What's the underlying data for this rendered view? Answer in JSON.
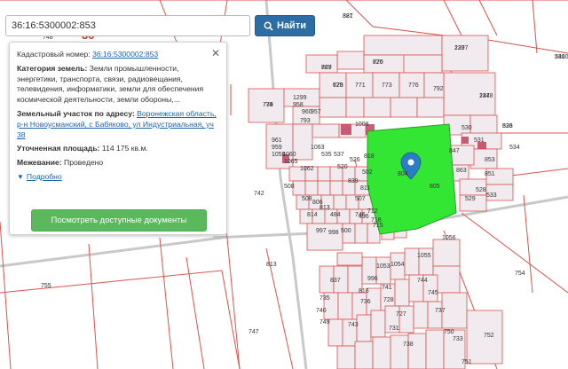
{
  "search": {
    "value": "36:16:5300002:853",
    "button_label": "Найти"
  },
  "popup": {
    "cadastral_label": "Кадастровый номер:",
    "cadastral_value": "36:16:5300002:853",
    "category_label": "Категория земель:",
    "category_value": "Земли промышленности, энергетики, транспорта, связи, радиовещания, телевидения, информатики, земли для обеспечения космической деятельности, земли обороны,...",
    "address_label": "Земельный участок по адресу:",
    "address_value": "Воронежская область, р-н Новоусманский, с Бабяково, ул Индустриальная, уч 38",
    "area_label": "Уточненная площадь:",
    "area_value": "114 175 кв.м.",
    "survey_label": "Межевание:",
    "survey_value": "Проведено",
    "more_label": "Подробно",
    "docs_button": "Посмотреть доступные документы"
  },
  "colors": {
    "parcel_line": "#d9534f",
    "parcel_fill": "#f1eaef",
    "selected_fill": "#33e633",
    "marker": "#2b7ec1",
    "road": "#c9c9c9"
  },
  "map_labels": [
    "30",
    "881",
    "1377",
    "5300",
    "1378",
    "536",
    "770",
    "769",
    "775",
    "779",
    "771",
    "773",
    "776",
    "792",
    "793",
    "1299",
    "958",
    "960",
    "957",
    "961",
    "959",
    "1059",
    "1060",
    "1065",
    "1062",
    "1063",
    "1008",
    "804",
    "805",
    "847",
    "863",
    "853",
    "851",
    "528",
    "529",
    "533",
    "534",
    "530",
    "531",
    "535",
    "537",
    "520",
    "526",
    "818",
    "839",
    "502",
    "811",
    "507",
    "508",
    "813",
    "508",
    "806",
    "814",
    "813",
    "484",
    "746",
    "712",
    "715",
    "718",
    "997",
    "998",
    "500",
    "496",
    "1055",
    "1056",
    "1054",
    "1053",
    "837",
    "816",
    "996",
    "741",
    "744",
    "745",
    "737",
    "728",
    "727",
    "731",
    "738",
    "736",
    "743",
    "750",
    "733",
    "751",
    "752",
    "754",
    "755",
    "742",
    "747",
    "735",
    "740",
    "749",
    "748",
    "327",
    "229",
    "241",
    "244",
    "823",
    "826",
    "827",
    "628",
    "734"
  ]
}
